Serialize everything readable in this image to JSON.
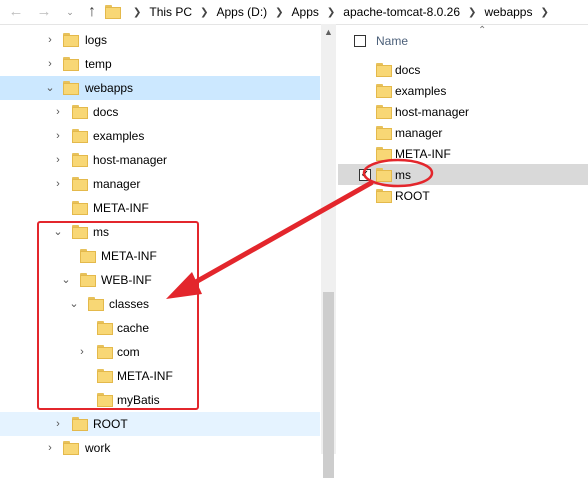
{
  "address_bar": {
    "back_icon": "arrow-left-icon",
    "forward_icon": "arrow-right-icon",
    "up_icon": "arrow-up-icon",
    "breadcrumbs": [
      "This PC",
      "Apps (D:)",
      "Apps",
      "apache-tomcat-8.0.26",
      "webapps"
    ]
  },
  "tree": {
    "items": [
      {
        "label": "logs"
      },
      {
        "label": "temp"
      },
      {
        "label": "webapps"
      },
      {
        "label": "docs"
      },
      {
        "label": "examples"
      },
      {
        "label": "host-manager"
      },
      {
        "label": "manager"
      },
      {
        "label": "META-INF"
      },
      {
        "label": "ms"
      },
      {
        "label": "META-INF"
      },
      {
        "label": "WEB-INF"
      },
      {
        "label": "classes"
      },
      {
        "label": "cache"
      },
      {
        "label": "com"
      },
      {
        "label": "META-INF"
      },
      {
        "label": "myBatis"
      },
      {
        "label": "ROOT"
      },
      {
        "label": "work"
      }
    ]
  },
  "file_list": {
    "header_name": "Name",
    "items": [
      {
        "label": "docs"
      },
      {
        "label": "examples"
      },
      {
        "label": "host-manager"
      },
      {
        "label": "manager"
      },
      {
        "label": "META-INF"
      },
      {
        "label": "ms"
      },
      {
        "label": "ROOT"
      }
    ],
    "selected_checkbox_glyph": "✓"
  },
  "colors": {
    "annotation": "#e3262c",
    "selection": "#cce8ff",
    "hover": "#e5f3ff",
    "folder": "#f8d775"
  }
}
